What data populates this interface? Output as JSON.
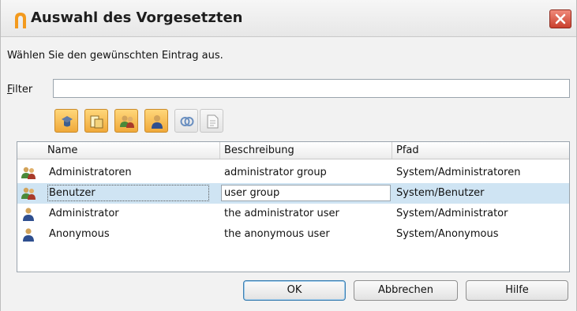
{
  "window": {
    "title": "Auswahl des Vorgesetzten",
    "close_icon": "close-icon",
    "title_icon": "app-logo-icon"
  },
  "prompt": "Wählen Sie den gewünschten Eintrag aus.",
  "filter": {
    "label_mnemonic": "F",
    "label_rest": "ilter",
    "value": "",
    "placeholder": ""
  },
  "toolbar": {
    "buttons": [
      {
        "icon": "role-filter-icon",
        "active": true
      },
      {
        "icon": "folder-filter-icon",
        "active": true
      },
      {
        "icon": "group-filter-icon",
        "active": true
      },
      {
        "icon": "user-filter-icon",
        "active": true
      },
      {
        "icon": "link-icon",
        "active": false
      },
      {
        "icon": "document-icon",
        "active": false
      }
    ]
  },
  "table": {
    "columns": [
      "Name",
      "Beschreibung",
      "Pfad"
    ],
    "rows": [
      {
        "icon": "group-icon",
        "name": "Administratoren",
        "description": "administrator group",
        "path": "System/Administratoren",
        "selected": false
      },
      {
        "icon": "group-icon",
        "name": "Benutzer",
        "description": "user group",
        "path": "System/Benutzer",
        "selected": true
      },
      {
        "icon": "user-icon",
        "name": "Administrator",
        "description": "the administrator user",
        "path": "System/Administrator",
        "selected": false
      },
      {
        "icon": "user-icon",
        "name": "Anonymous",
        "description": "the anonymous user",
        "path": "System/Anonymous",
        "selected": false
      }
    ]
  },
  "buttons": {
    "ok": "OK",
    "cancel": "Abbrechen",
    "help": "Hilfe"
  },
  "colors": {
    "selection": "#cfe4f3",
    "accent_orange": "#f0a93a",
    "close_red": "#c9402e"
  }
}
